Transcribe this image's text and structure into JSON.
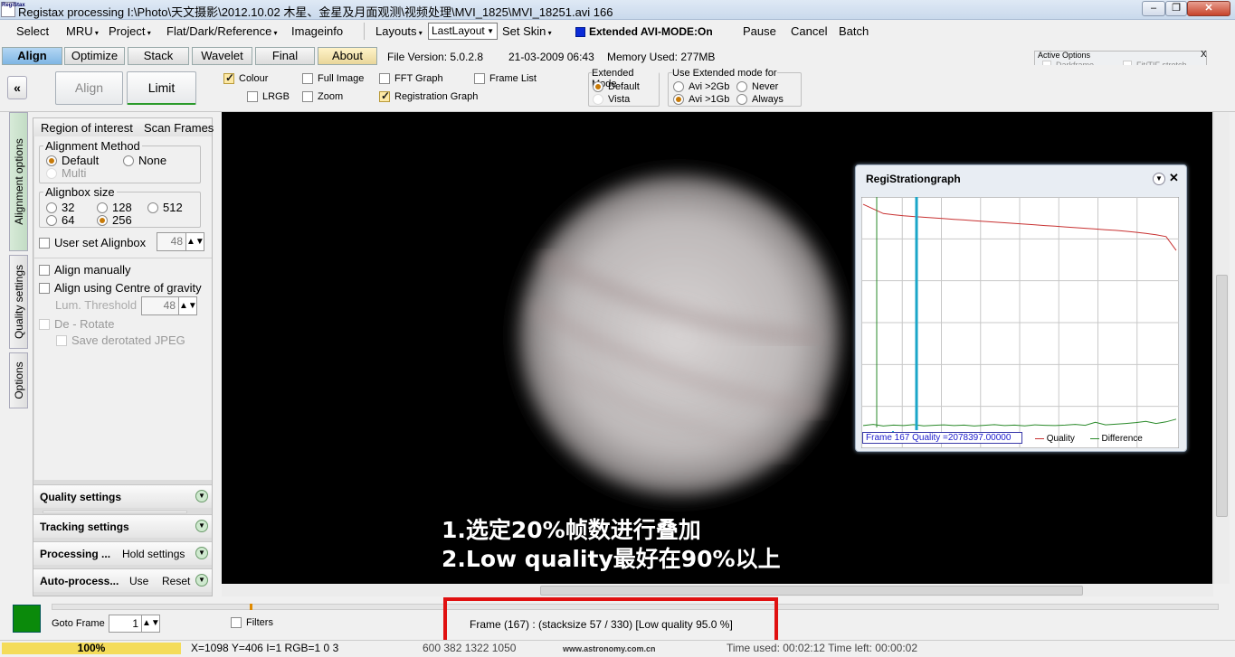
{
  "window": {
    "title": "Registax processing I:\\Photo\\天文摄影\\2012.10.02 木星、金星及月面观测\\视频处理\\MVI_1825\\MVI_18251.avi 166",
    "icon_text": "RegiStax"
  },
  "menu": {
    "select": "Select",
    "mru": "MRU",
    "project": "Project",
    "flat": "Flat/Dark/Reference",
    "imageinfo": "Imageinfo",
    "layouts": "Layouts",
    "layout_value": "LastLayout",
    "skin": "Set Skin",
    "extended": "Extended AVI-MODE:On",
    "pause": "Pause",
    "cancel": "Cancel",
    "batch": "Batch"
  },
  "tabs": {
    "align": "Align",
    "optimize": "Optimize",
    "stack": "Stack",
    "wavelet": "Wavelet",
    "final": "Final",
    "about": "About",
    "version": "File Version: 5.0.2.8",
    "date": "21-03-2009 06:43",
    "memory": "Memory Used: 277MB"
  },
  "toolbar": {
    "collapse": "«",
    "align_btn": "Align",
    "limit_btn": "Limit",
    "colour": "Colour",
    "lrgb": "LRGB",
    "full_image": "Full Image",
    "zoom": "Zoom",
    "fft": "FFT Graph",
    "reg_graph": "Registration Graph",
    "frame_list": "Frame List"
  },
  "ext_mode": {
    "title": "Extended Mode",
    "default": "Default",
    "vista": "Vista"
  },
  "use_ext": {
    "title": "Use  Extended mode for",
    "avi2": "Avi >2Gb",
    "avi1": "Avi >1Gb",
    "never": "Never",
    "always": "Always"
  },
  "active_options": {
    "title": "Active Options",
    "close": "X",
    "items_left": [
      "Darkframe",
      "Flatfield",
      "Debayer",
      "Interlace"
    ],
    "items_right": [
      "Fit/TIF stretch",
      "Filtering",
      "Resample",
      "Region.O.I."
    ]
  },
  "side_tabs": {
    "alignment": "Alignment options",
    "quality": "Quality settings",
    "options": "Options"
  },
  "left": {
    "roi": "Region of interest",
    "scan": "Scan Frames",
    "method_title": "Alignment Method",
    "m_default": "Default",
    "m_none": "None",
    "m_multi": "Multi",
    "box_title": "Alignbox size",
    "s32": "32",
    "s128": "128",
    "s512": "512",
    "s64": "64",
    "s256": "256",
    "user_box": "User set Alignbox",
    "user_box_val": "48",
    "align_manual": "Align manually",
    "gravity": "Align using Centre of gravity",
    "lum": "Lum. Threshold",
    "lum_val": "48",
    "derotate": "De - Rotate",
    "save_jpeg": "Save derotated JPEG"
  },
  "sections": {
    "quality": "Quality settings",
    "tracking": "Tracking settings",
    "processing": "Processing ...",
    "hold": "Hold settings",
    "auto": "Auto-process...",
    "use": "Use",
    "reset": "Reset"
  },
  "graph": {
    "title": "RegiStrationgraph",
    "frame_info": "Frame 167 Quality =2078397.00000",
    "legend_quality": "Quality",
    "legend_diff": "Difference"
  },
  "caption": {
    "line1": "1.选定20%帧数进行叠加",
    "line2": "2.Low quality最好在90%以上"
  },
  "bottom": {
    "goto": "Goto Frame",
    "goto_val": "1",
    "filters": "Filters",
    "frame_status": "Frame (167) :   (stacksize 57 / 330) [Low quality 95.0 %]"
  },
  "status": {
    "percent": "100%",
    "coords": "X=1098 Y=406 I=1 RGB=1 0 3",
    "roi": "600 382 1322 1050",
    "watermark": "www.astronomy.com.cn",
    "time": "Time used: 00:02:12 Time left: 00:00:02"
  },
  "colors": {
    "accent": "#0b9a0b",
    "highlight": "#e01010",
    "quality_line": "#c83232",
    "difference_line": "#2a8a2a",
    "marker_cyan": "#1aa6c8",
    "progress": "#f4dc5a"
  },
  "chart_data": {
    "type": "line",
    "title": "RegiStrationgraph",
    "xlabel": "",
    "ylabel": "",
    "series": [
      {
        "name": "Quality",
        "color": "#c83232",
        "values": [
          98,
          96,
          94,
          93.5,
          93,
          92.7,
          92.4,
          92.1,
          91.8,
          91.5,
          91.2,
          90.9,
          90.6,
          90.3,
          90,
          89.7,
          89.4,
          89.1,
          88.8,
          88.5,
          88.2,
          87.9,
          87.6,
          87.3,
          87,
          86.7,
          86.3,
          85.9,
          85.4,
          84.8,
          84,
          78
        ]
      },
      {
        "name": "Difference",
        "color": "#2a8a2a",
        "values": [
          2,
          2.5,
          1.8,
          2.2,
          2,
          2.4,
          1.9,
          2.1,
          2.3,
          2,
          2.2,
          1.8,
          2.1,
          2.4,
          2,
          2.2,
          1.9,
          2.3,
          2.1,
          2,
          2.2,
          2.5,
          2.1,
          3.4,
          2.3,
          2.6,
          2.9,
          3.3,
          3.8,
          2.9,
          3.6,
          4.8
        ]
      }
    ],
    "ylim": [
      0,
      100
    ],
    "legend": "bottom-right",
    "grid": true
  }
}
